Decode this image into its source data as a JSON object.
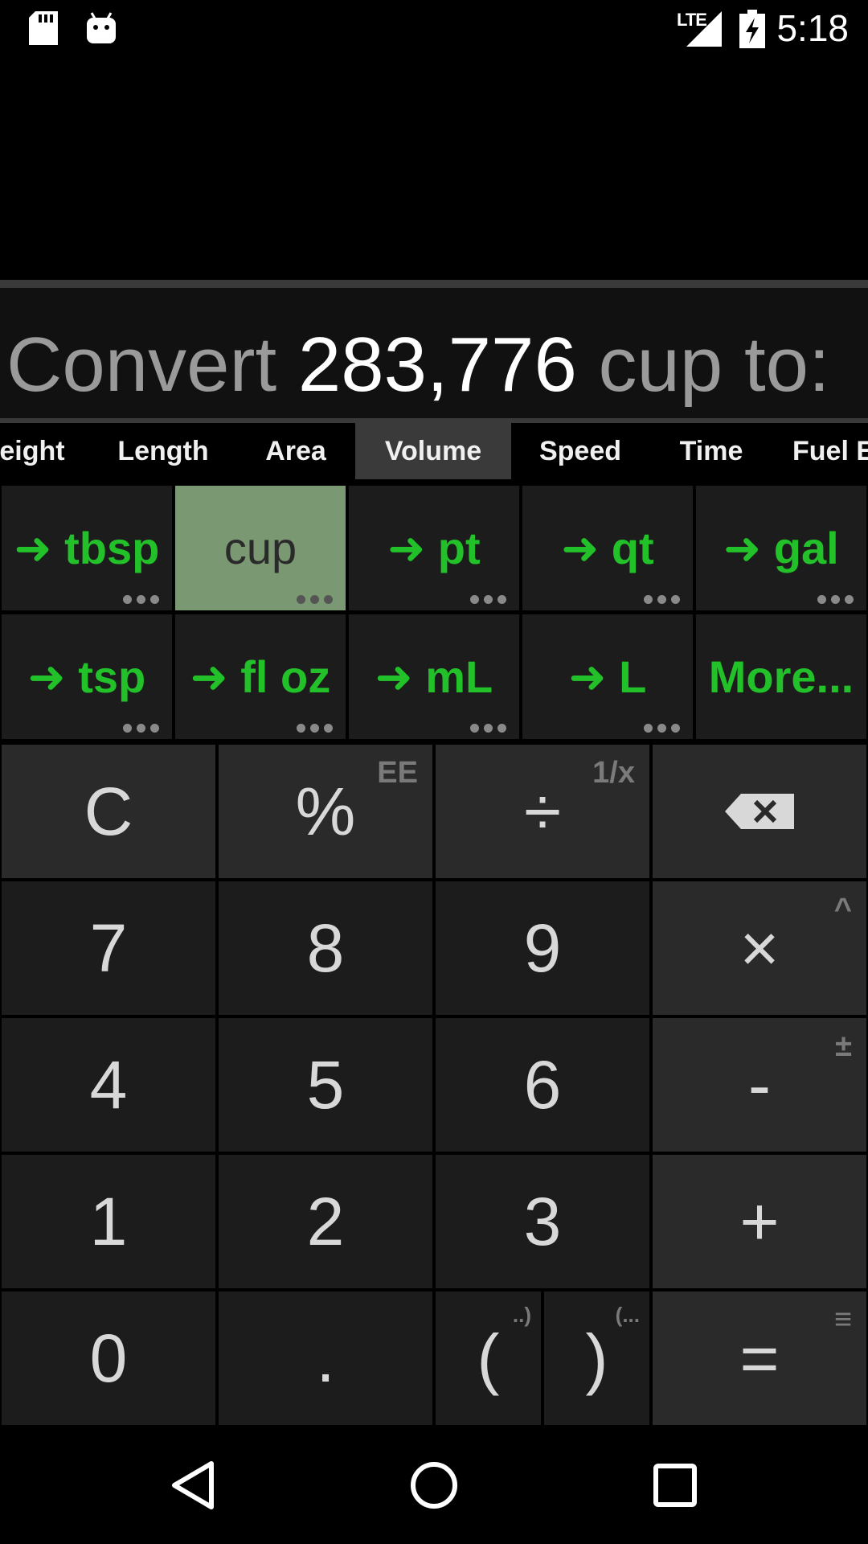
{
  "status_bar": {
    "time": "5:18",
    "network": "LTE",
    "icons": [
      "sd-card-icon",
      "android-icon",
      "signal-icon",
      "battery-charging-icon"
    ]
  },
  "display": {
    "prefix": "Convert",
    "value": "283,776",
    "unit": "cup",
    "suffix": "to:"
  },
  "categories": {
    "items": [
      "eight",
      "Length",
      "Area",
      "Volume",
      "Speed",
      "Time",
      "Fuel E"
    ],
    "active": "Volume"
  },
  "units": {
    "row1": [
      {
        "label": "➜ tbsp"
      },
      {
        "label": "cup",
        "selected": true
      },
      {
        "label": "➜ pt"
      },
      {
        "label": "➜ qt"
      },
      {
        "label": "➜ gal"
      }
    ],
    "row2": [
      {
        "label": "➜ tsp"
      },
      {
        "label": "➜ fl oz"
      },
      {
        "label": "➜ mL"
      },
      {
        "label": "➜ L"
      },
      {
        "label": "More..."
      }
    ]
  },
  "keypad": {
    "clear": "C",
    "percent": "%",
    "percent_sub": "EE",
    "divide": "÷",
    "divide_sub": "1/x",
    "k7": "7",
    "k8": "8",
    "k9": "9",
    "multiply": "×",
    "multiply_sub": "^",
    "k4": "4",
    "k5": "5",
    "k6": "6",
    "minus": "-",
    "minus_sub": "±",
    "k1": "1",
    "k2": "2",
    "k3": "3",
    "plus": "+",
    "k0": "0",
    "dot": ".",
    "open_paren": "(",
    "open_paren_sub": "..)",
    "close_paren": ")",
    "close_paren_sub": "(...",
    "equals": "=",
    "equals_sub": "≡"
  },
  "colors": {
    "accent_green": "#22c12a",
    "selected_unit_bg": "#7a9872",
    "active_tab_bg": "#3a3a3a"
  }
}
